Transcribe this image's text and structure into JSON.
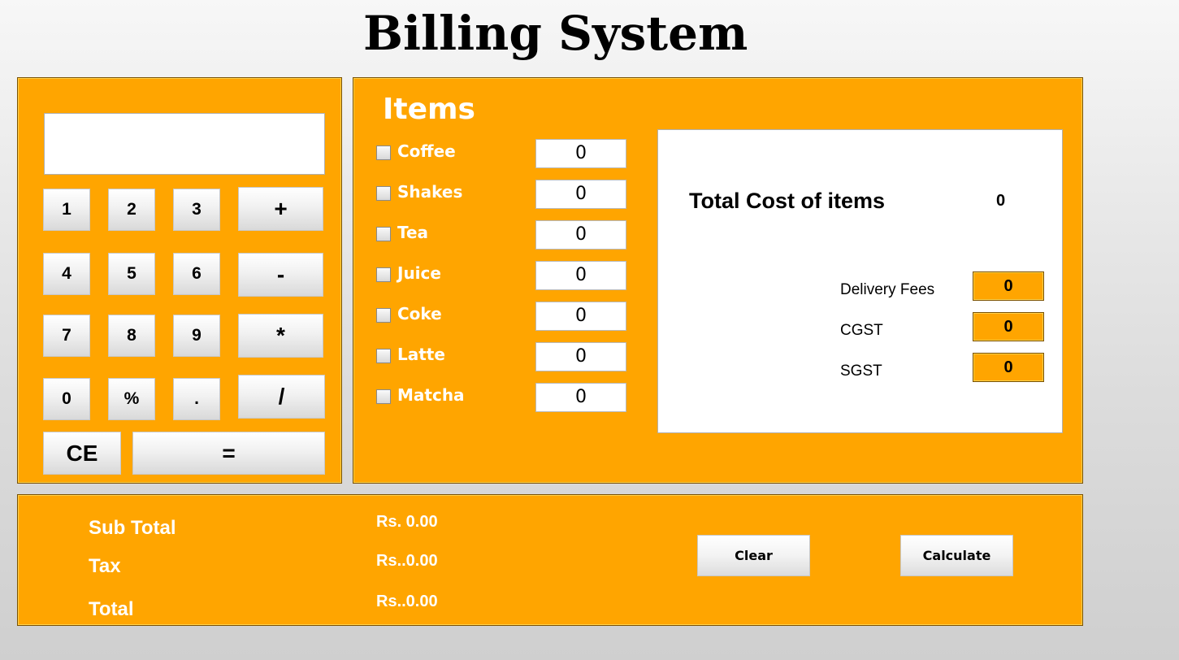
{
  "title": "Billing System",
  "calculator": {
    "display_value": "",
    "buttons": {
      "b1": "1",
      "b2": "2",
      "b3": "3",
      "plus": "+",
      "b4": "4",
      "b5": "5",
      "b6": "6",
      "minus": "-",
      "b7": "7",
      "b8": "8",
      "b9": "9",
      "multiply": "*",
      "b0": "0",
      "percent": "%",
      "dot": ".",
      "divide": "/",
      "ce": "CE",
      "equals": "="
    }
  },
  "items": {
    "heading": "Items",
    "list": [
      {
        "label": "Coffee",
        "qty": "0",
        "checked": false
      },
      {
        "label": "Shakes",
        "qty": "0",
        "checked": false
      },
      {
        "label": "Tea",
        "qty": "0",
        "checked": false
      },
      {
        "label": "Juice",
        "qty": "0",
        "checked": false
      },
      {
        "label": "Coke",
        "qty": "0",
        "checked": false
      },
      {
        "label": "Latte",
        "qty": "0",
        "checked": false
      },
      {
        "label": "Matcha",
        "qty": "0",
        "checked": false
      }
    ]
  },
  "summary": {
    "total_cost_label": "Total Cost of items",
    "total_cost_value": "0",
    "delivery_fees_label": "Delivery Fees",
    "delivery_fees_value": "0",
    "cgst_label": "CGST",
    "cgst_value": "0",
    "sgst_label": "SGST",
    "sgst_value": "0"
  },
  "totals": {
    "sub_total_label": "Sub Total",
    "sub_total_value": "Rs. 0.00",
    "tax_label": "Tax",
    "tax_value": "Rs..0.00",
    "total_label": "Total",
    "total_value": "Rs..0.00",
    "clear_label": "Clear",
    "calculate_label": "Calculate"
  },
  "colors": {
    "panel": "#ffa500",
    "panel_border": "#7a5000",
    "text_light": "#ffffff"
  }
}
